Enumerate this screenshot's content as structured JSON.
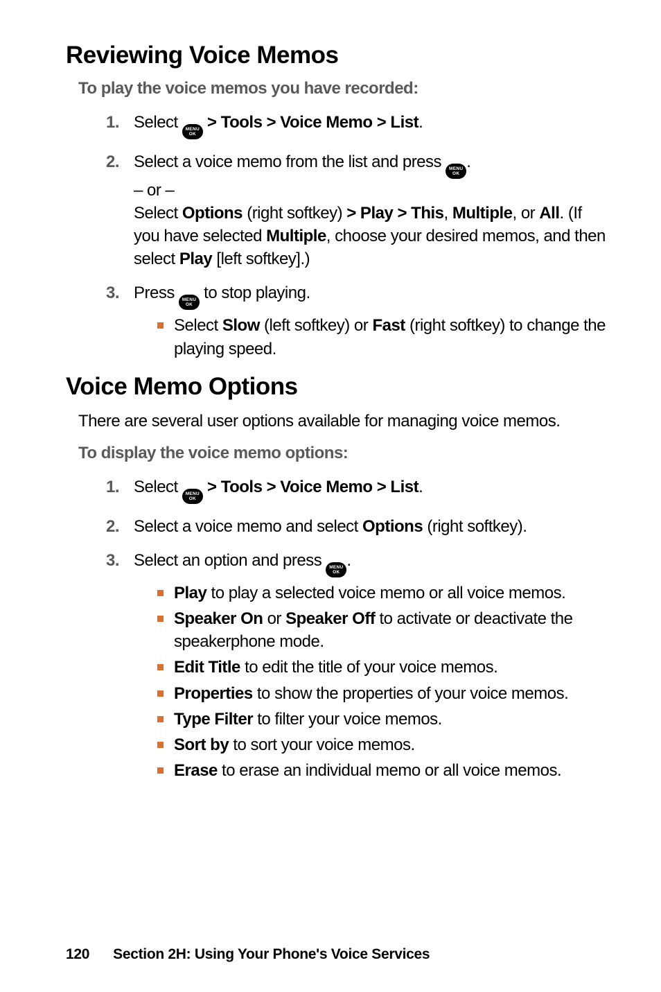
{
  "section1": {
    "title": "Reviewing Voice Memos",
    "lead": "To play the voice memos you have recorded:",
    "steps": [
      {
        "pre": "Select ",
        "post": " > Tools > Voice Memo > List",
        "tail": "."
      },
      {
        "line1_a": "Select a voice memo from the list and press ",
        "line1_b": ".",
        "or": "– or –",
        "line2_a": "Select ",
        "line2_b": "Options",
        "line2_c": " (right softkey) ",
        "line2_d": "> Play > This",
        "line2_e": ", ",
        "line2_f": "Multiple",
        "line2_g": ", or ",
        "line2_h": "All",
        "line2_i": ". (If you have selected ",
        "line2_j": "Multiple",
        "line2_k": ", choose your desired memos, and then select ",
        "line2_l": "Play",
        "line2_m": " [left softkey].)"
      },
      {
        "line_a": "Press ",
        "line_b": " to stop playing.",
        "sub_a": "Select ",
        "sub_b": "Slow",
        "sub_c": " (left softkey) or ",
        "sub_d": "Fast",
        "sub_e": " (right softkey) to change the playing speed."
      }
    ]
  },
  "section2": {
    "title": "Voice Memo Options",
    "intro": "There are several user options available for managing voice memos.",
    "lead": "To display the voice memo options:",
    "steps": [
      {
        "pre": "Select ",
        "post": " > Tools > Voice Memo > List",
        "tail": "."
      },
      {
        "a": "Select a voice memo and select ",
        "b": "Options",
        "c": " (right softkey)."
      },
      {
        "a": "Select an option and press ",
        "b": ".",
        "subs": [
          {
            "b": "Play",
            "t": " to play a selected voice memo or all voice memos."
          },
          {
            "b": "Speaker On",
            "mid": " or ",
            "b2": "Speaker Off",
            "t": " to activate or deactivate the speakerphone mode."
          },
          {
            "b": "Edit Title",
            "t": " to edit the title of your voice memos."
          },
          {
            "b": "Properties",
            "t": " to show the properties of your voice memos."
          },
          {
            "b": "Type Filter",
            "t": " to filter your voice memos."
          },
          {
            "b": "Sort by",
            "t": " to sort your voice memos."
          },
          {
            "b": "Erase",
            "t": " to erase an individual memo or all voice memos."
          }
        ]
      }
    ]
  },
  "icon": {
    "top": "MENU",
    "bot": "OK"
  },
  "footer": {
    "page": "120",
    "section": "Section 2H: Using Your Phone's Voice Services"
  }
}
